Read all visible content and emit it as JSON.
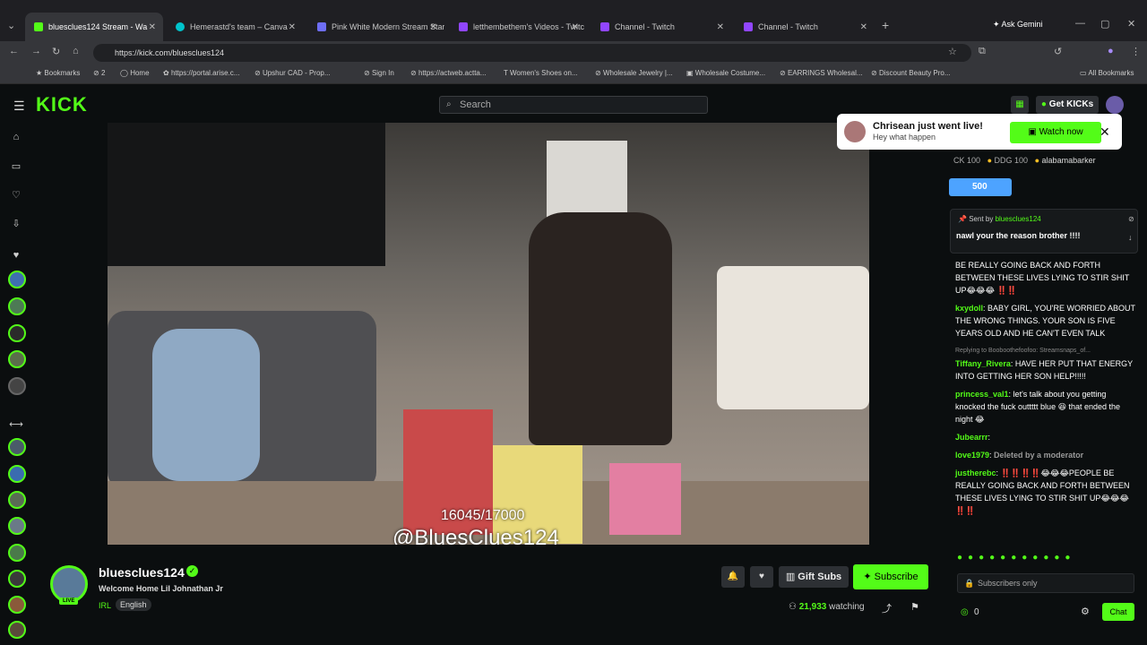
{
  "browser": {
    "tabs": [
      {
        "label": "bluesclues124 Stream - Wa",
        "color": "#53fc18"
      },
      {
        "label": "Hemerastd's team – Canva",
        "color": "#00c4cc"
      },
      {
        "label": "Pink White Modern Stream Star",
        "color": "#6e6ef5"
      },
      {
        "label": "letthembethem's Videos - Twitc",
        "color": "#9146ff"
      },
      {
        "label": "Channel - Twitch",
        "color": "#9146ff"
      },
      {
        "label": "Channel - Twitch",
        "color": "#9146ff"
      }
    ],
    "ask_gemini": "Ask Gemini",
    "url": "https://kick.com/bluesclues124",
    "bookmarks": [
      "Bookmarks",
      "2",
      "Home",
      "https://portal.arise.c...",
      "Upshur CAD - Prop...",
      "Sign In",
      "https://actweb.actta...",
      "Women's Shoes on...",
      "Wholesale Jewelry |...",
      "Wholesale Costume...",
      "EARRINGS Wholesal...",
      "Discount Beauty Pro..."
    ],
    "all_bookmarks": "All Bookmarks"
  },
  "kick": {
    "logo": "KICK",
    "search_placeholder": "Search",
    "get_kicks": "Get KICKs",
    "accent": "#53fc18"
  },
  "toast": {
    "title": "Chrisean just went live!",
    "subtitle": "Hey what happen",
    "button": "Watch now"
  },
  "video": {
    "counter": "16045/17000",
    "handle": "@BluesClues124"
  },
  "streamer": {
    "name": "bluesclues124",
    "title": "Welcome Home Lil Johnathan Jr",
    "category": "IRL",
    "language": "English",
    "live": "LIVE",
    "gift_subs": "Gift Subs",
    "subscribe": "Subscribe",
    "viewers": "21,933",
    "watching": "watching"
  },
  "chat": {
    "top_gifters": [
      {
        "name": "CK",
        "amount": "100"
      },
      {
        "name": "DDG",
        "amount": "100"
      },
      {
        "name": "alabamabarker",
        "amount": ""
      }
    ],
    "gift_amount": "500",
    "pinned": {
      "sent_by": "Sent by",
      "user": "bluesclues124",
      "message": "nawl your the reason brother !!!!"
    },
    "messages": [
      {
        "user": "",
        "text": "BE REALLY GOING BACK AND FORTH BETWEEN THESE LIVES LYING TO STIR SHIT UP😂😂😂 ‼️‼️",
        "reply": ""
      },
      {
        "user": "kxydoll",
        "text": "BABY GIRL, YOU'RE WORRIED ABOUT THE WRONG THINGS. YOUR SON IS FIVE YEARS OLD AND HE CAN'T EVEN TALK",
        "reply": ""
      },
      {
        "user": "Tiffany_Rivera",
        "text": "HAVE HER PUT THAT ENERGY INTO GETTING HER SON HELP!!!!!",
        "reply": "Replying to Booboothefoofoo: Streamsnaps_of..."
      },
      {
        "user": "princess_val1",
        "text": "let's talk about you getting knocked the fuck outtttt blue 😆 that ended the night 😂",
        "reply": ""
      },
      {
        "user": "Jubearrr",
        "text": "",
        "reply": ""
      },
      {
        "user": "love1979",
        "text": "Deleted by a moderator",
        "reply": ""
      },
      {
        "user": "justherebc",
        "text": "‼️‼️‼️‼️😂😂😂PEOPLE BE REALLY GOING BACK AND FORTH BETWEEN THESE LIVES LYING TO STIR SHIT UP😂😂😂 ‼️‼️",
        "reply": ""
      }
    ],
    "input_placeholder": "Subscribers only",
    "chat_button": "Chat",
    "points": "0"
  }
}
